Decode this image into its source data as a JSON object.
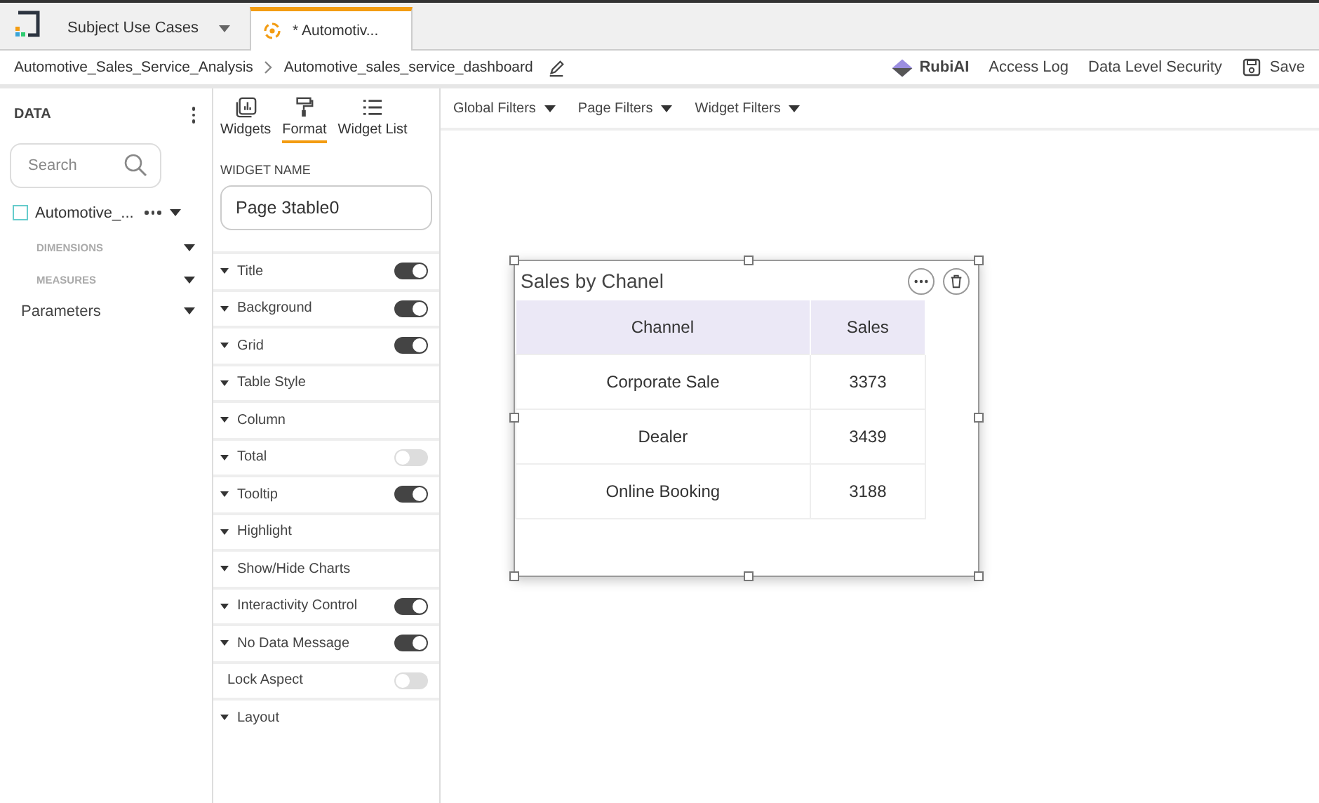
{
  "tabs": [
    {
      "label": "Subject Use Cases",
      "selected": false,
      "kind": "dropdown"
    },
    {
      "label": "* Automotiv...",
      "selected": true,
      "kind": "doc"
    }
  ],
  "breadcrumb": [
    "Automotive_Sales_Service_Analysis",
    "Automotive_sales_service_dashboard"
  ],
  "header_actions": [
    {
      "label": "RubiAI",
      "kind": "brand"
    },
    {
      "label": "Access Log",
      "kind": "link"
    },
    {
      "label": "Data Level Security",
      "kind": "link"
    },
    {
      "label": "Save",
      "kind": "save"
    }
  ],
  "data_panel": {
    "title": "DATA",
    "search": {
      "placeholder": "Search"
    },
    "source": "Automotive_...",
    "groups": [
      "DIMENSIONS",
      "MEASURES"
    ],
    "parameters": "Parameters"
  },
  "panel_tabs": [
    {
      "label": "Widgets",
      "selected": false,
      "kind": "widgets"
    },
    {
      "label": "Format",
      "selected": true,
      "kind": "format"
    },
    {
      "label": "Widget List",
      "selected": false,
      "kind": "list"
    }
  ],
  "widget_name": {
    "label": "WIDGET NAME",
    "value": "Page 3table0"
  },
  "format_rows": [
    {
      "label": "Title",
      "collapsible": true,
      "kind": "toggle",
      "on": true
    },
    {
      "label": "Background",
      "collapsible": true,
      "kind": "toggle",
      "on": true
    },
    {
      "label": "Grid",
      "collapsible": true,
      "kind": "toggle",
      "on": true
    },
    {
      "label": "Table Style",
      "collapsible": true,
      "kind": "section"
    },
    {
      "label": "Column",
      "collapsible": true,
      "kind": "section"
    },
    {
      "label": "Total",
      "collapsible": true,
      "kind": "toggle",
      "on": false
    },
    {
      "label": "Tooltip",
      "collapsible": true,
      "kind": "toggle",
      "on": true
    },
    {
      "label": "Highlight",
      "collapsible": true,
      "kind": "section"
    },
    {
      "label": "Show/Hide Charts",
      "collapsible": true,
      "kind": "section"
    },
    {
      "label": "Interactivity Control",
      "collapsible": true,
      "kind": "toggle",
      "on": true
    },
    {
      "label": "No Data Message",
      "collapsible": true,
      "kind": "toggle",
      "on": true
    },
    {
      "label": "Lock Aspect",
      "collapsible": false,
      "kind": "toggle",
      "on": false
    },
    {
      "label": "Layout",
      "collapsible": true,
      "kind": "section"
    }
  ],
  "filters": [
    "Global Filters",
    "Page Filters",
    "Widget Filters"
  ],
  "widget": {
    "title": "Sales by Chanel",
    "table": {
      "columns": [
        "Channel",
        "Sales"
      ],
      "rows": [
        [
          "Corporate Sale",
          "3373"
        ],
        [
          "Dealer",
          "3439"
        ],
        [
          "Online Booking",
          "3188"
        ]
      ]
    }
  }
}
